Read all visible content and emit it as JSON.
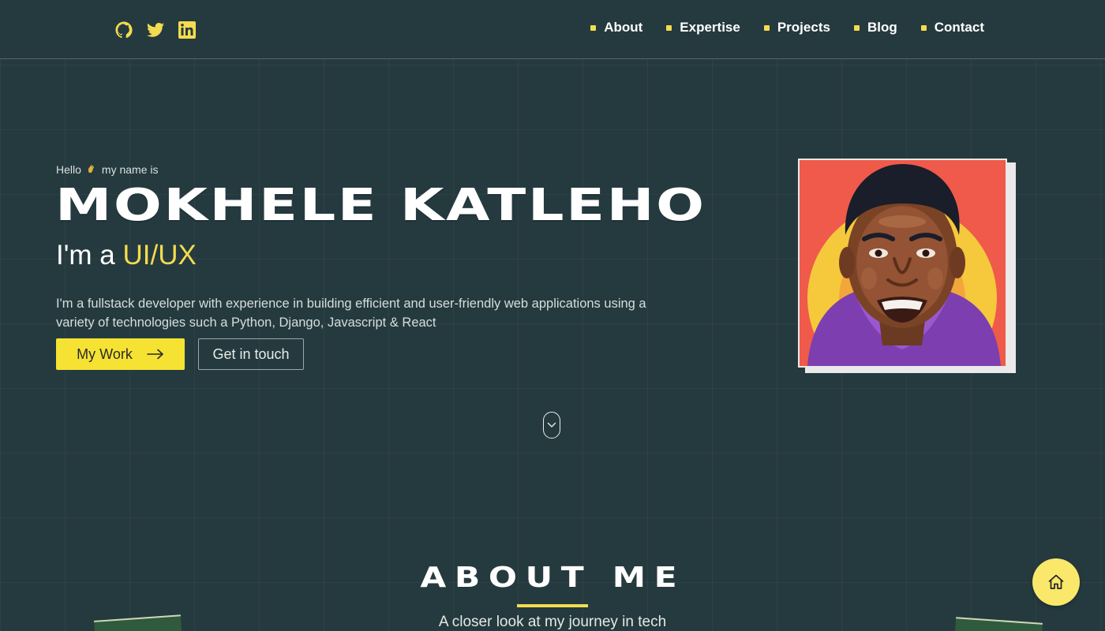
{
  "header": {
    "social": [
      {
        "icon": "github-icon"
      },
      {
        "icon": "twitter-icon"
      },
      {
        "icon": "linkedin-icon"
      }
    ],
    "nav": [
      {
        "label": "About"
      },
      {
        "label": "Expertise"
      },
      {
        "label": "Projects"
      },
      {
        "label": "Blog"
      },
      {
        "label": "Contact"
      }
    ]
  },
  "hero": {
    "greeting_before": "Hello",
    "greeting_after": "my name is",
    "name": "MOKHELE KATLEHO",
    "role_prefix": "I'm a",
    "role_highlight": "UI/UX",
    "description": "I'm a fullstack developer with experience in building efficient and user-friendly web applications using a variety of technologies such a Python, Django, Javascript & React",
    "primary_button": "My Work",
    "secondary_button": "Get in touch"
  },
  "about": {
    "title": "ABOUT ME",
    "subtitle": "A closer look at my journey in tech"
  },
  "colors": {
    "background": "#253a3f",
    "accent": "#f3dc4f",
    "button": "#f6e233",
    "home_button": "#f9e86a"
  }
}
